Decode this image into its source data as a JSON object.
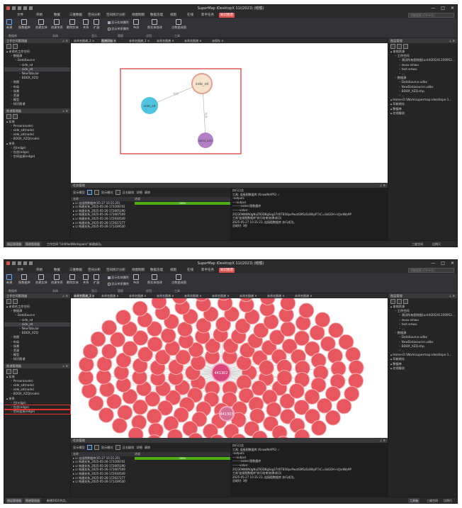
{
  "app": {
    "title": "SuperMap iDesktopX 11i(2023) (暗模)",
    "window_controls": [
      "—",
      "□",
      "✕"
    ]
  },
  "ribbon": {
    "tabs": [
      "文件",
      "开始",
      "数据",
      "三维数据",
      "空间分析",
      "空间统计分析",
      "地图制图",
      "数据治理",
      "视图",
      "在线",
      "新手任务",
      "知识图谱"
    ],
    "active_tab": "知识图谱",
    "search_placeholder": "功能搜索 (Ctrl+Q)",
    "buttons": [
      "新建",
      "图数据库",
      "创建实体",
      "创建关系",
      "删除实体",
      "关系",
      "扩展",
      "布局",
      "连接",
      "图管理"
    ],
    "checkboxes": [
      {
        "label": "显示实体属性",
        "checked": true
      },
      {
        "label": "显示关系属性",
        "checked": false
      }
    ],
    "misc_buttons": [
      "实体类型",
      "图数据库",
      "图实体修改",
      "点数据成图"
    ],
    "groups": [
      "数据库",
      "实体",
      "显示",
      "管理",
      "应用",
      "工具"
    ]
  },
  "left_panel": {
    "workspace_title": "工作空间管理器",
    "graph_title": "图谱管理器",
    "tree1": [
      {
        "label": "未命名工作空间",
        "level": 0
      },
      {
        "label": "数据源",
        "level": 1
      },
      {
        "label": "DataSource",
        "level": 2
      },
      {
        "label": "side_sd",
        "level": 3
      },
      {
        "label": "side_zd",
        "level": 3
      },
      {
        "label": "NewTabular",
        "level": 3
      },
      {
        "label": "BDOX_XZQ",
        "level": 3
      },
      {
        "label": "地图",
        "level": 1
      },
      {
        "label": "布局",
        "level": 1
      },
      {
        "label": "场景",
        "level": 1
      },
      {
        "label": "资源",
        "level": 1
      },
      {
        "label": "模型",
        "level": 1
      },
      {
        "label": "知识图谱",
        "level": 1
      }
    ],
    "tree2": [
      {
        "label": "实体",
        "level": 0
      },
      {
        "label": "Person(node)",
        "level": 1
      },
      {
        "label": "side_sd(node)",
        "level": 1
      },
      {
        "label": "side_zd(node)",
        "level": 1
      },
      {
        "label": "BDOX_XZQ(node)",
        "level": 1
      },
      {
        "label": "关系",
        "level": 0
      },
      {
        "label": "归(edge)",
        "level": 1
      },
      {
        "label": "包含(edge)",
        "level": 1
      },
      {
        "label": "空间连接(edge)",
        "level": 1
      }
    ]
  },
  "doc_tabs_1": [
    "未命名图谱_2 ✕",
    "图谱初始 ✕",
    "未命名图谱_1 ✕",
    "未命名图谱 ✕",
    "未命名图谱 ✕",
    "未保存 ✕"
  ],
  "doc_tabs_2": [
    "未命名图谱_3 ✕",
    "未命名图谱 ✕",
    "未命名图谱 ✕",
    "未命名图谱 ✕",
    "未命名图谱 ✕",
    "未命名图谱 ✕",
    "未命名图谱 ✕",
    "未命名图谱 ✕",
    "未命名图谱 ✕"
  ],
  "graph1": {
    "nodes": [
      {
        "label": "side_sd",
        "color": "#4fc3e0"
      },
      {
        "label": "side_zd",
        "color": "#f4e2cc"
      },
      {
        "label": "BDOX_XZQ",
        "color": "#b27fc4"
      }
    ],
    "edges": [
      "空间",
      "包含"
    ]
  },
  "graph2": {
    "hub_labels": [
      "441302",
      "441303"
    ],
    "node_color": "#e8575f"
  },
  "right_panel": {
    "title": "图层管理",
    "items": [
      {
        "label": "本地资源",
        "level": 0
      },
      {
        "label": "工作空间",
        "level": 1
      },
      {
        "label": "测试所有图地图(untitl20241100952...",
        "level": 2
      },
      {
        "label": "wsxx.smwu",
        "level": 2
      },
      {
        "label": "test.smwu",
        "level": 2
      },
      {
        "label": "…",
        "level": 2
      },
      {
        "label": "数据源",
        "level": 1
      },
      {
        "label": "DataSource.udbx",
        "level": 2
      },
      {
        "label": "NewDatasource.udbx",
        "level": 2
      },
      {
        "label": "BDOX_XZQ.shp",
        "level": 2
      },
      {
        "label": "…",
        "level": 2
      },
      {
        "label": "Home-D:\\Work\\supermap-idesktopx-1...",
        "level": 0
      },
      {
        "label": "导航地址",
        "level": 0
      },
      {
        "label": "数据库",
        "level": 0
      },
      {
        "label": "在线服务",
        "level": 0
      }
    ],
    "tab_1": "资源管理",
    "tab_2": "工具箱"
  },
  "task_panel": {
    "title": "任务管理",
    "toolbar_labels": [
      "显示模型",
      "显示模式",
      "日志级别",
      "详细",
      "清除"
    ],
    "columns": [
      "名称",
      "进度"
    ],
    "rows": [
      {
        "name": "连接图数据库(05-27 10:31:20)",
        "progress": 1.0,
        "progress_text": "100%"
      },
      {
        "name": "构建关系_2025-05-26-173206741",
        "progress": null,
        "progress_text": ""
      },
      {
        "name": "构建关系_2025-05-26-172605190",
        "progress": null,
        "progress_text": ""
      },
      {
        "name": "构建关系_2025-05-26-173007509",
        "progress": null,
        "progress_text": ""
      },
      {
        "name": "构建关系_2025-05-26-172930549",
        "progress": null,
        "progress_text": ""
      },
      {
        "name": "构建关系_2025-05-26-172627277",
        "progress": null,
        "progress_text": ""
      },
      {
        "name": "构建关系_2025-05-26-171339520",
        "progress": null,
        "progress_text": ""
      }
    ],
    "log_title": "执行日志",
    "log_lines": [
      "工具: 连接图数据库 (KnowNetPG) ✓",
      "-outputs",
      "----output",
      "--------name:图数据库",
      "-------value:",
      "20230NN0N0gNaZR0D8gSsg37d0T8X8pxPwatSMSzSaNhpP7sC=SkGOH+UJndWy9P",
      "工具'连接图数据库'执行结束(结果成功)",
      "2025-05-27 10:31:23, 连接图数据库 执行成功。",
      "总耗时: 3秒"
    ]
  },
  "status1": {
    "tabs": [
      "图层管理器",
      "图谱管理器"
    ],
    "message": "工作空间 \"UntitledWorkspace\" 新建成功。",
    "right": [
      "三维空间",
      "比例尺"
    ]
  },
  "status2": {
    "tabs": [
      "图层管理器",
      "图谱管理器"
    ],
    "message": "新增1021节点。",
    "right": [
      "工具箱",
      "三维空间",
      "比例尺"
    ]
  }
}
